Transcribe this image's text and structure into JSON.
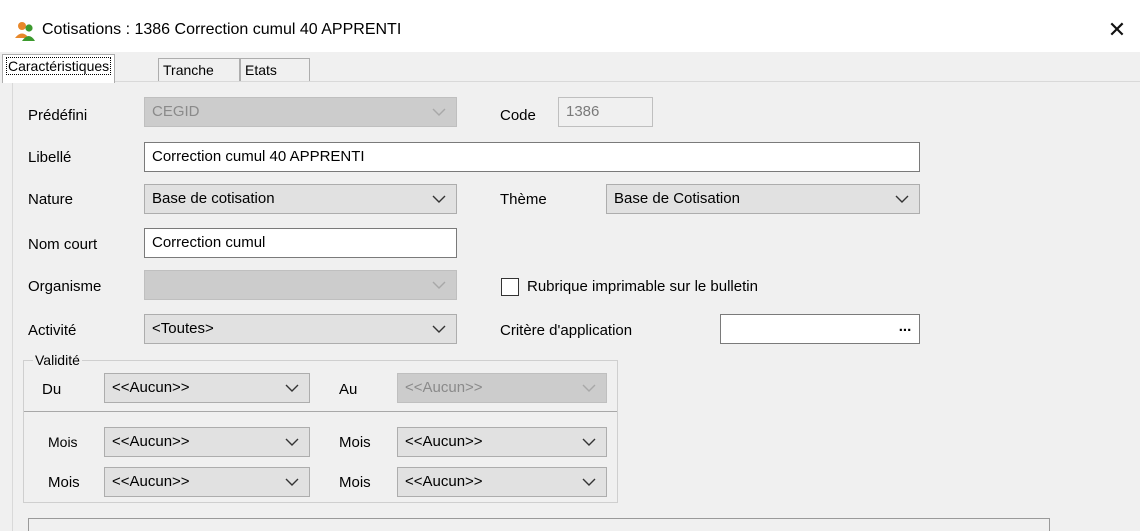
{
  "window": {
    "title": "Cotisations  : 1386 Correction cumul 40 APPRENTI",
    "close_glyph": "✕"
  },
  "tabs": [
    {
      "label": "Caractéristiques",
      "active": true
    },
    {
      "label": "Tranche",
      "active": false
    },
    {
      "label": "Etats",
      "active": false
    }
  ],
  "form": {
    "predefini": {
      "label": "Prédéfini",
      "value": "CEGID"
    },
    "code": {
      "label": "Code",
      "value": "1386"
    },
    "libelle": {
      "label": "Libellé",
      "value": "Correction cumul 40 APPRENTI"
    },
    "nature": {
      "label": "Nature",
      "value": "Base de cotisation"
    },
    "theme": {
      "label": "Thème",
      "value": "Base de Cotisation"
    },
    "nom_court": {
      "label": "Nom court",
      "value": "Correction cumul"
    },
    "organisme": {
      "label": "Organisme",
      "value": ""
    },
    "rubrique_imprimable": {
      "label": "Rubrique imprimable sur le bulletin",
      "checked": false
    },
    "activite": {
      "label": "Activité",
      "value": "<Toutes>"
    },
    "critere": {
      "label": "Critère d'application",
      "value": "",
      "button": "..."
    }
  },
  "validite": {
    "legend": "Validité",
    "du": {
      "label": "Du",
      "value": "<<Aucun>>"
    },
    "au": {
      "label": "Au",
      "value": "<<Aucun>>"
    },
    "mois_rows": [
      {
        "left_label": "Mois",
        "left_value": "<<Aucun>>",
        "right_label": "Mois",
        "right_value": "<<Aucun>>"
      },
      {
        "left_label": "Mois",
        "left_value": "<<Aucun>>",
        "right_label": "Mois",
        "right_value": "<<Aucun>>"
      }
    ]
  },
  "colors": {
    "window_bg": "#f0f0f0",
    "field_bg": "#e1e1e1",
    "disabled_bg": "#cccccc",
    "icon_green": "#3c9a2e",
    "icon_orange": "#e8882a"
  }
}
